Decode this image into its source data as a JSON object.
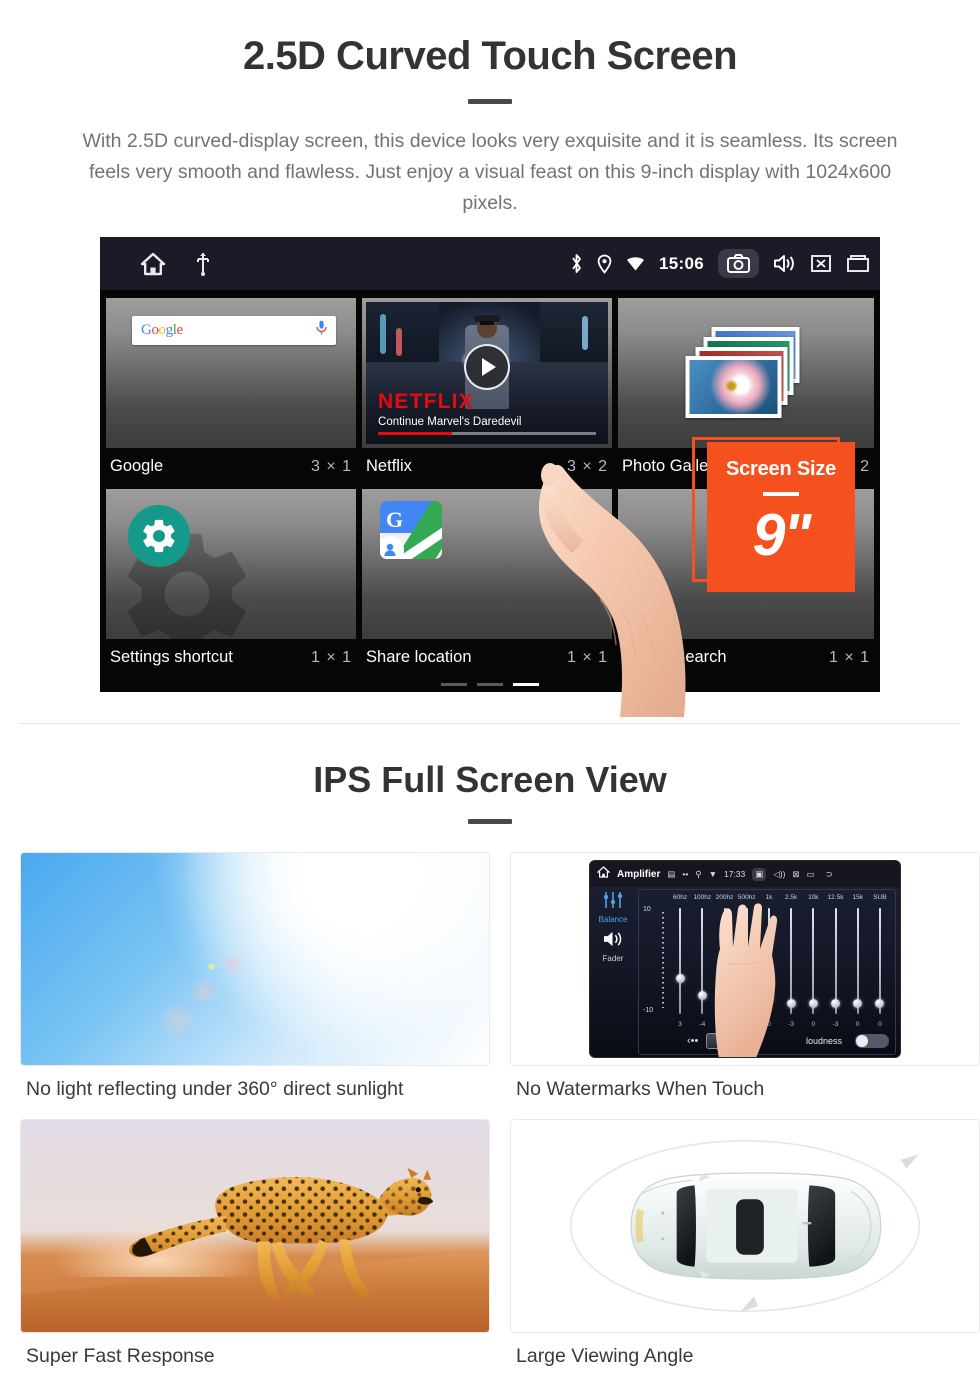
{
  "section1": {
    "title": "2.5D Curved Touch Screen",
    "description": "With 2.5D curved-display screen, this device looks very exquisite and it is seamless. Its screen feels very smooth and flawless. Just enjoy a visual feast on this 9-inch display with 1024x600 pixels.",
    "badge": {
      "label": "Screen Size",
      "value": "9\"",
      "color": "#f4511e"
    },
    "android": {
      "statusbar": {
        "time": "15:06",
        "left_icons": [
          "home-icon",
          "usb-icon"
        ],
        "right_icons": [
          "bluetooth-icon",
          "location-icon",
          "wifi-icon",
          "camera-icon",
          "volume-icon",
          "close-icon",
          "recents-icon"
        ]
      },
      "widgets": [
        {
          "name": "Google",
          "size": "3 × 1",
          "search_placeholder": "Google",
          "icon": "google-search-widget"
        },
        {
          "name": "Netflix",
          "size": "3 × 2",
          "brand": "NETFLIX",
          "subtitle": "Continue Marvel's Daredevil",
          "icon": "play-icon"
        },
        {
          "name": "Photo Gallery",
          "size": "2 × 2",
          "icon": "photo-stack-icon"
        },
        {
          "name": "Settings shortcut",
          "size": "1 × 1",
          "icon": "gear-icon"
        },
        {
          "name": "Share location",
          "size": "1 × 1",
          "icon": "google-maps-icon"
        },
        {
          "name": "Sound Search",
          "size": "1 × 1",
          "icon": "music-note-icon"
        }
      ],
      "page_indicator": {
        "count": 3,
        "active": 3
      }
    }
  },
  "section2": {
    "title": "IPS Full Screen View",
    "cards": [
      {
        "caption": "No light reflecting under 360° direct sunlight",
        "image": "sunlight-photo"
      },
      {
        "caption": "No Watermarks When Touch",
        "image": "amplifier-screenshot"
      },
      {
        "caption": "Super Fast Response",
        "image": "cheetah-photo"
      },
      {
        "caption": "Large Viewing Angle",
        "image": "car-top-view"
      }
    ],
    "amplifier": {
      "title": "Amplifier",
      "time": "17:33",
      "side_labels": [
        "Balance",
        "Fader"
      ],
      "scale_top": "10",
      "scale_bottom": "-10",
      "bands": [
        "60hz",
        "100hz",
        "200hz",
        "500hz",
        "1k",
        "2.5k",
        "10k",
        "12.5k",
        "15k",
        "SUB"
      ],
      "values": [
        "3",
        "-4",
        "0",
        "0",
        "0",
        "-3",
        "0",
        "-3",
        "0",
        "0"
      ],
      "preset_button": "Custom",
      "loudness_label": "loudness"
    }
  }
}
